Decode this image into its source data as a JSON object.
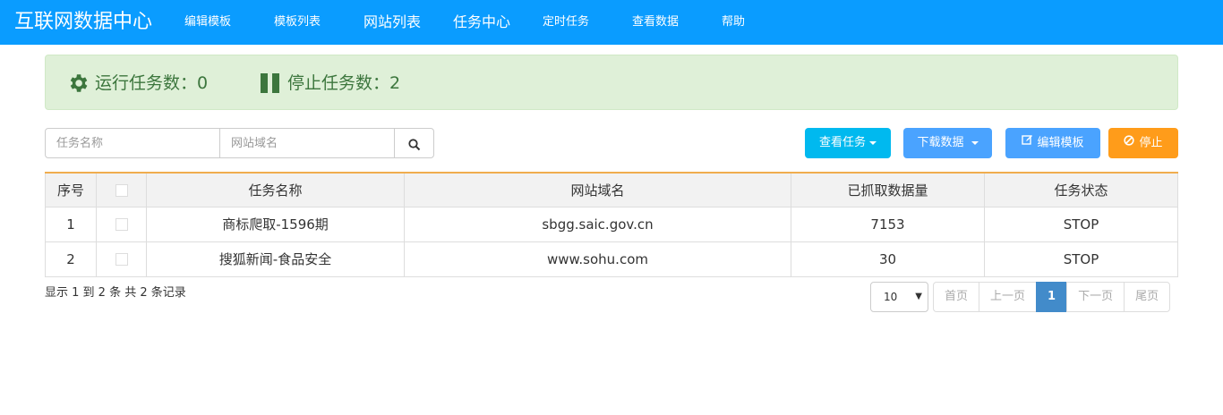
{
  "nav": {
    "brand": "互联网数据中心",
    "items": [
      {
        "label": "编辑模板"
      },
      {
        "label": "模板列表"
      },
      {
        "label": "网站列表"
      },
      {
        "label": "任务中心"
      },
      {
        "label": "定时任务"
      },
      {
        "label": "查看数据"
      },
      {
        "label": "帮助"
      }
    ]
  },
  "stats": {
    "running_label": "运行任务数：0",
    "stopped_label": "停止任务数：2",
    "running_icon": "gear-icon",
    "stopped_icon": "pause-icon"
  },
  "search": {
    "task_placeholder": "任务名称",
    "site_placeholder": "网站域名",
    "search_icon": "search-icon"
  },
  "toolbar": {
    "view_tasks_label": "查看任务",
    "download_label": "下载数据",
    "edit_template_label": "编辑模板",
    "stop_label": "停止",
    "colors": {
      "view": "#00b9ef",
      "download": "#4aa3ff",
      "edit": "#4aa3ff",
      "stop": "#ff9c1a"
    }
  },
  "table": {
    "headers": [
      "序号",
      "",
      "任务名称",
      "网站域名",
      "已抓取数据量",
      "任务状态"
    ],
    "rows": [
      {
        "index": "1",
        "name": "商标爬取-1596期",
        "domain": "sbgg.saic.gov.cn",
        "count": "7153",
        "status": "STOP"
      },
      {
        "index": "2",
        "name": "搜狐新闻-食品安全",
        "domain": "www.sohu.com",
        "count": "30",
        "status": "STOP"
      }
    ]
  },
  "footer": {
    "summary": "显示 1 到 2 条 共 2 条记录",
    "page_size": "10",
    "pages": {
      "first": "首页",
      "prev": "上一页",
      "current": "1",
      "next": "下一页",
      "last": "尾页"
    }
  }
}
